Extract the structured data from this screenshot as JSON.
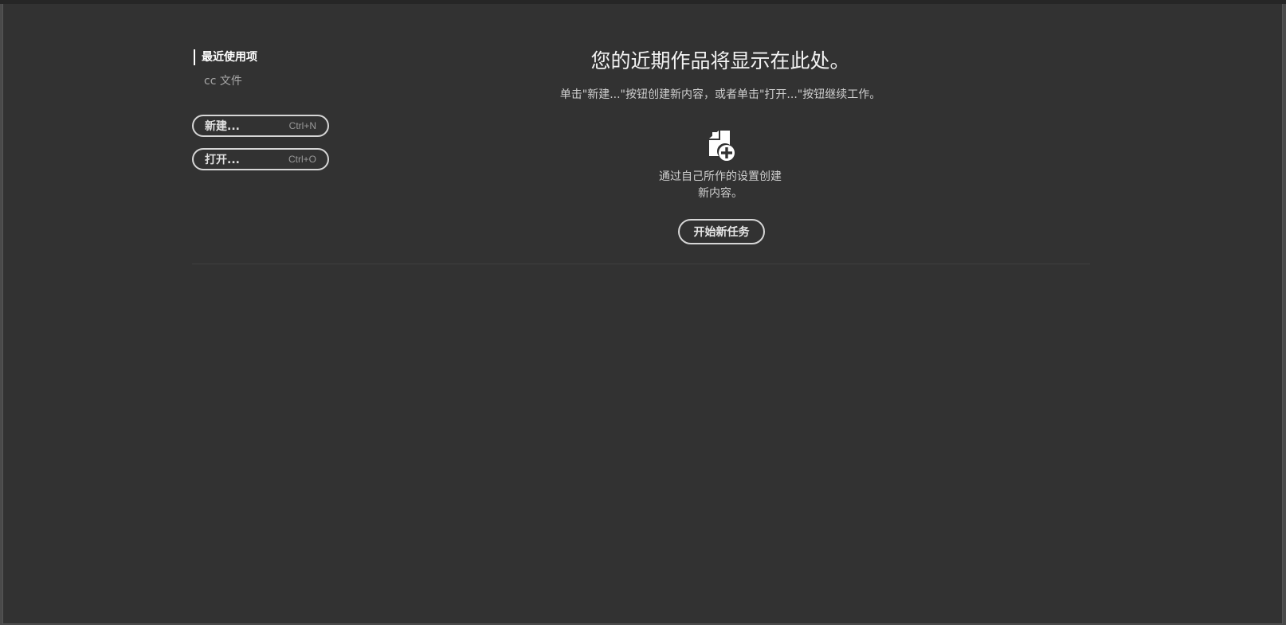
{
  "sidebar": {
    "tabs": [
      {
        "label": "最近使用项"
      },
      {
        "label": "cc 文件"
      }
    ],
    "buttons": [
      {
        "label": "新建...",
        "shortcut": "Ctrl+N"
      },
      {
        "label": "打开...",
        "shortcut": "Ctrl+O"
      }
    ]
  },
  "main": {
    "title": "您的近期作品将显示在此处。",
    "subtitle": "单击\"新建...\"按钮创建新内容，或者单击\"打开...\"按钮继续工作。",
    "create": {
      "icon": "new-document-icon",
      "description_line1": "通过自己所作的设置创建",
      "description_line2": "新内容。",
      "button_label": "开始新任务"
    }
  },
  "colors": {
    "background": "#323232",
    "text": "#ffffff",
    "muted": "#a8a8a8",
    "button_border": "#d6d6d6"
  }
}
